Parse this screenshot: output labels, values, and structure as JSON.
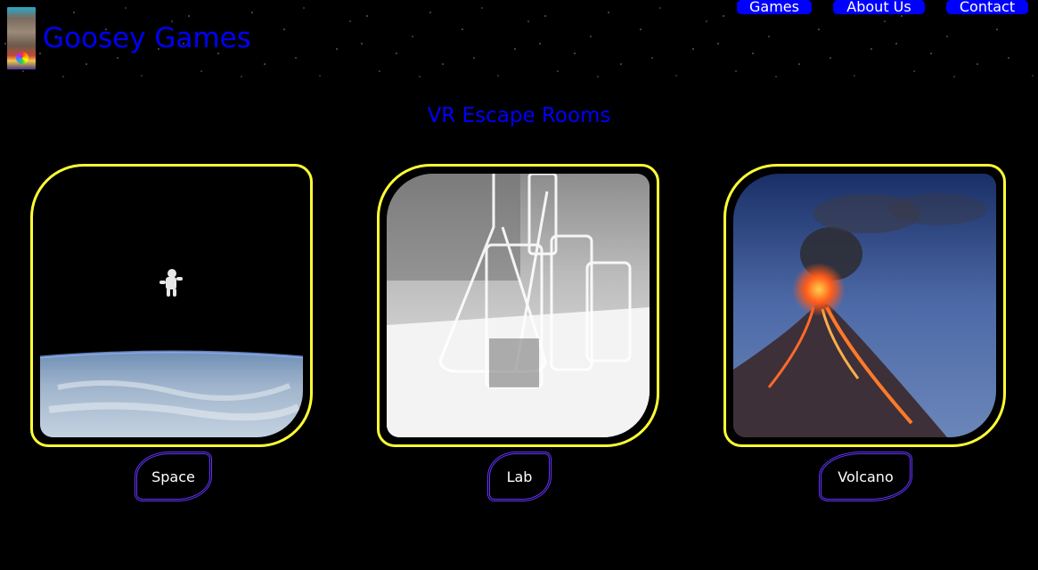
{
  "site": {
    "brand": "Goosey Games",
    "logo": "goosey-logo-image"
  },
  "nav": {
    "items": [
      {
        "label": "Games"
      },
      {
        "label": "About Us"
      },
      {
        "label": "Contact"
      }
    ]
  },
  "page": {
    "title": "VR Escape Rooms"
  },
  "rooms": [
    {
      "label": "Space",
      "image": "astronaut-over-earth"
    },
    {
      "label": "Lab",
      "image": "glass-beakers-lab"
    },
    {
      "label": "Volcano",
      "image": "erupting-volcano"
    }
  ],
  "colors": {
    "brand": "#0000ff",
    "card_border": "#ffff33",
    "label_border": "#6633ff",
    "background": "#000000"
  }
}
